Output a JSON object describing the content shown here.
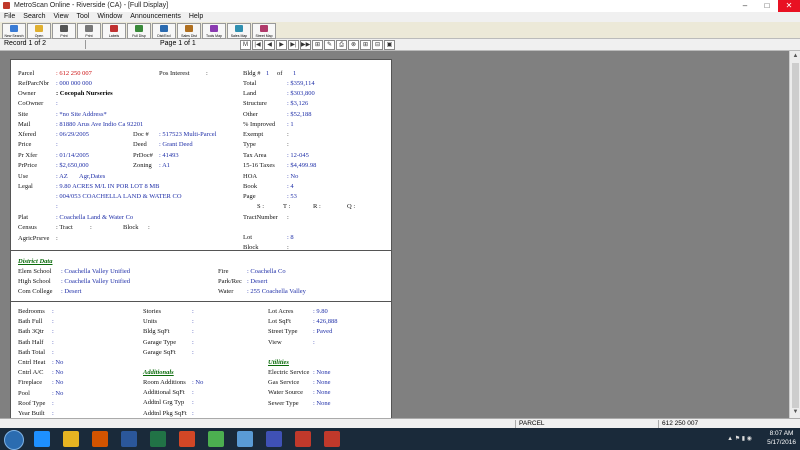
{
  "window": {
    "title": "MetroScan Online - Riverside (CA) - [Full Display]",
    "min": "–",
    "max": "□",
    "close": "✕"
  },
  "menu": [
    "File",
    "Search",
    "View",
    "Tool",
    "Window",
    "Announcements",
    "Help"
  ],
  "toolbar": [
    {
      "label": "New Search",
      "color": "#3a7bd5"
    },
    {
      "label": "Open",
      "color": "#e0b030"
    },
    {
      "label": "Print",
      "color": "#555555"
    },
    {
      "label": "Print",
      "color": "#777777"
    },
    {
      "label": "Labels",
      "color": "#c03030"
    },
    {
      "label": "Full Disp",
      "color": "#3a8a3a"
    },
    {
      "label": "Dist/Excl",
      "color": "#2a6ab0"
    },
    {
      "label": "Sales Dist",
      "color": "#b07020"
    },
    {
      "label": "Tools Map",
      "color": "#8a3ab0"
    },
    {
      "label": "Sales Map",
      "color": "#3090b0"
    },
    {
      "label": "Street Map",
      "color": "#b03a6a"
    }
  ],
  "nav": {
    "record": "Record 1 of 2",
    "page": "Page 1 of 1",
    "buttons": [
      "M",
      "|◀",
      "◀",
      "▶",
      "▶|",
      "▶▶",
      "⊞",
      "✎",
      "⎙",
      "⊗",
      "⊞",
      "⊟",
      "▣"
    ]
  },
  "parcel": {
    "parcel_label": "Parcel",
    "parcel_value": ": 612 250 007",
    "refparc_label": "RefParcNbr",
    "refparc_value": ": 000 000 000",
    "owner_label": "Owner",
    "owner_value": ": Cocopah Nurseries",
    "coowner_label": "CoOwner",
    "coowner_value": ":",
    "site_label": "Site",
    "site_value": ": *no Site Address*",
    "mail_label": "Mail",
    "mail_value": ": 81880 Arus Ave Indio Ca 92201",
    "xfered_label": "Xfered",
    "xfered_value": ": 06/29/2005",
    "price_label": "Price",
    "price_value": ":",
    "prxfer_label": "Pr Xfer",
    "prxfer_value": ": 01/14/2005",
    "prprice_label": "PrPrice",
    "prprice_value": ": $2,650,000",
    "use_label": "Use",
    "use_value": ": AZ",
    "use_desc": "Agr,Dates",
    "legal_label": "Legal",
    "legal_value1": ": 9.80 ACRES M/L IN POR LOT 8 MB",
    "legal_value2": ": 004/053 COACHELLA LAND & WATER CO",
    "legal_value3": ":",
    "plat_label": "Plat",
    "plat_value": ": Coachella Land & Water Co",
    "census_label": "Census",
    "census_tract": ": Tract",
    "census_tract_colon": ":",
    "census_block": "Block",
    "census_block_colon": ":",
    "agric_label": "AgricPrsrve",
    "agric_value": ":",
    "posint_label": "Pos Interest",
    "posint_value": ":",
    "doc_label": "Doc #",
    "doc_value": ": 517523 Multi-Parcel",
    "deed_label": "Deed",
    "deed_value": ": Grant Deed",
    "prdoc_label": "PrDoc#",
    "prdoc_value": ": 41493",
    "zoning_label": "Zoning",
    "zoning_value": ": A1",
    "bldg_label": "Bldg #",
    "bldg_value": "1",
    "bldg_of": "of",
    "bldg_total": "1",
    "total_label": "Total",
    "total_value": ": $359,114",
    "land_label": "Land",
    "land_value": ": $303,800",
    "structure_label": "Structure",
    "structure_value": ": $3,126",
    "other_label": "Other",
    "other_value": ": $52,188",
    "improved_label": "% Improved",
    "improved_value": ": 1",
    "exempt_label": "Exempt",
    "exempt_value": ":",
    "type_label": "Type",
    "type_value": ":",
    "taxarea_label": "Tax Area",
    "taxarea_value": ": 12-045",
    "taxes_label": "15-16 Taxes",
    "taxes_value": ": $4,499.98",
    "hoa_label": "HOA",
    "hoa_value": ": No",
    "book_label": "Book",
    "book_value": ": 4",
    "page_label": "Page",
    "page_value": ": 53",
    "s_label": "S :",
    "t_label": "T :",
    "r_label": "R :",
    "q_label": "Q :",
    "tract_label": "TractNumber",
    "tract_value": ":",
    "lot_label": "Lot",
    "lot_value": ": 8",
    "block_label": "Block",
    "block_value": ":"
  },
  "district": {
    "title": "District Data",
    "elem_label": "Elem School",
    "elem_value": ": Coachella Valley Unified",
    "high_label": "High School",
    "high_value": ": Coachella Valley Unified",
    "com_label": "Com College",
    "com_value": ": Desert",
    "fire_label": "Fire",
    "fire_value": ": Coachella Co",
    "park_label": "Park/Rec",
    "park_value": ": Desert",
    "water_label": "Water",
    "water_value": ": 255 Coachella Valley"
  },
  "building": {
    "left": [
      {
        "label": "Bedrooms",
        "value": ":"
      },
      {
        "label": "Bath Full",
        "value": ":"
      },
      {
        "label": "Bath 3Qtr",
        "value": ":"
      },
      {
        "label": "Bath Half",
        "value": ":"
      },
      {
        "label": "Bath Total",
        "value": ":"
      },
      {
        "label": "Cntrl Heat",
        "value": ": No"
      },
      {
        "label": "Cntrl A/C",
        "value": ": No"
      },
      {
        "label": "Fireplace",
        "value": ": No"
      },
      {
        "label": "Pool",
        "value": ": No"
      },
      {
        "label": "Roof Type",
        "value": ":"
      },
      {
        "label": "Year Built",
        "value": ":"
      }
    ],
    "mid": [
      {
        "label": "Stories",
        "value": ":"
      },
      {
        "label": "Units",
        "value": ":"
      },
      {
        "label": "Bldg SqFt",
        "value": ":"
      },
      {
        "label": "Garage Type",
        "value": ":"
      },
      {
        "label": "Garage SqFt",
        "value": ":"
      }
    ],
    "additionals_title": "Additionals",
    "additionals": [
      {
        "label": "Room Additions",
        "value": ": No"
      },
      {
        "label": "Additional SqFt",
        "value": ":"
      },
      {
        "label": "Addtnl Grg Typ",
        "value": ":"
      },
      {
        "label": "Addtnl Pkg SqFt",
        "value": ":"
      }
    ],
    "right": [
      {
        "label": "Lot Acres",
        "value": ": 9.80"
      },
      {
        "label": "Lot SqFt",
        "value": ": 426,888"
      },
      {
        "label": "Street Type",
        "value": ": Paved"
      },
      {
        "label": "View",
        "value": ":"
      }
    ],
    "utilities_title": "Utilities",
    "utilities": [
      {
        "label": "Electric Service",
        "value": ": None"
      },
      {
        "label": "Gas Service",
        "value": ": None"
      },
      {
        "label": "Water Source",
        "value": ": None"
      },
      {
        "label": "Sewer Type",
        "value": ": None"
      }
    ]
  },
  "status": {
    "mode": "PARCEL",
    "parcel": "612 250 007"
  },
  "taskbar": {
    "time": "8:07 AM",
    "date": "5/17/2016",
    "apps": [
      "ie",
      "folder",
      "media",
      "word",
      "excel",
      "outlook",
      "chrome",
      "network",
      "edge",
      "metroscan1",
      "metroscan2"
    ],
    "app_colors": [
      "#1e90ff",
      "#e6b422",
      "#d35400",
      "#2b579a",
      "#217346",
      "#d24726",
      "#4caf50",
      "#5a9bd5",
      "#3f51b5",
      "#c0392b",
      "#c0392b"
    ]
  }
}
